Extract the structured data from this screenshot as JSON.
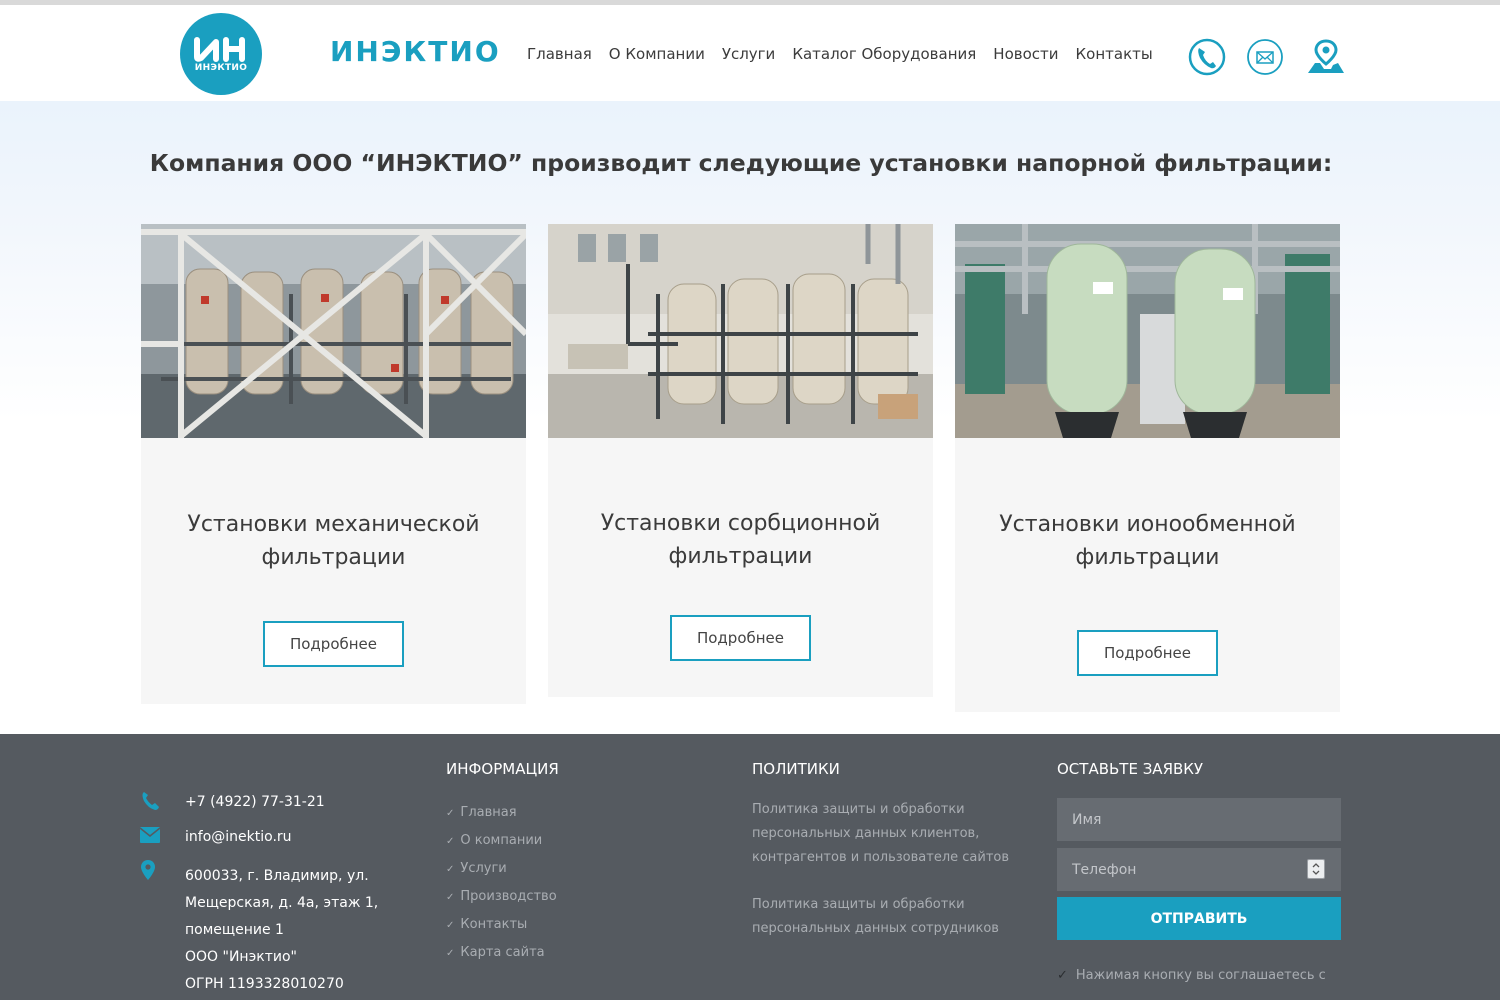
{
  "header": {
    "logo_text": "ИН",
    "logo_sub": "ИНЭКТИО",
    "brand": "ИНЭКТИО",
    "nav": [
      "Главная",
      "О Компании",
      "Услуги",
      "Каталог Оборудования",
      "Новости",
      "Контакты"
    ],
    "icons": [
      "phone-icon",
      "mail-icon",
      "map-pin-icon"
    ]
  },
  "hero": {
    "title": "Компания ООО “ИНЭКТИО” производит следующие установки напорной фильтрации:",
    "cards": [
      {
        "title_line1": "Установки механической",
        "title_line2": "фильтрации",
        "button": "Подробнее"
      },
      {
        "title_line1": "Установки сорбционной",
        "title_line2": "фильтрации",
        "button": "Подробнее"
      },
      {
        "title_line1": "Установки ионообменной",
        "title_line2": "фильтрации",
        "button": "Подробнее"
      }
    ]
  },
  "footer": {
    "phone": "+7 (4922) 77-31-21",
    "email": "info@inektio.ru",
    "address_lines": [
      "600033, г. Владимир, ул.",
      "Мещерская, д. 4а, этаж 1,",
      "помещение 1",
      "ООО \"Инэктио\"",
      "ОГРН 1193328010270"
    ],
    "info_heading": "ИНФОРМАЦИЯ",
    "info_links": [
      "Главная",
      "О компании",
      "Услуги",
      "Производство",
      "Контакты",
      "Карта сайта"
    ],
    "policies_heading": "ПОЛИТИКИ",
    "policy1_lines": [
      "Политика защиты и обработки",
      "персональных данных клиентов,",
      "контрагентов и пользователе сайтов"
    ],
    "policy2_lines": [
      "Политика защиты и обработки",
      "персональных данных сотрудников"
    ],
    "form_heading": "ОСТАВЬТЕ ЗАЯВКУ",
    "name_placeholder": "Имя",
    "phone_placeholder": "Телефон",
    "submit": "ОТПРАВИТЬ",
    "consent": "Нажимая кнопку вы соглашаетесь с"
  },
  "colors": {
    "accent": "#1a9fc0",
    "footer_bg": "#555a60",
    "card_bg": "#f6f6f6"
  }
}
